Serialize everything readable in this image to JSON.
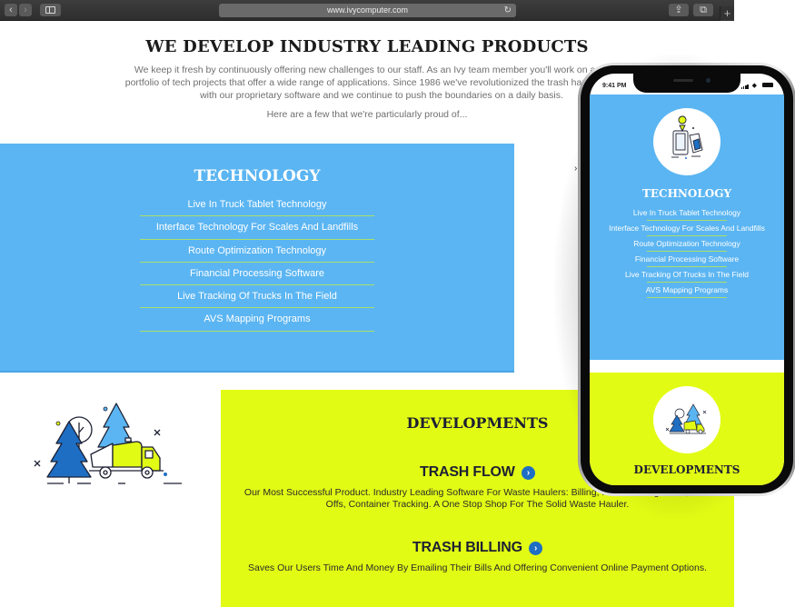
{
  "browser": {
    "url": "www.ivycomputer.com",
    "icons": [
      "back-icon",
      "forward-icon",
      "sidebar-icon",
      "reload-icon",
      "share-icon",
      "tabs-icon",
      "new-tab-icon"
    ]
  },
  "hero": {
    "title": "WE DEVELOP INDUSTRY LEADING PRODUCTS",
    "lines": [
      "We keep it fresh by continuously offering new challenges to our staff. As an Ivy team member you'll work on a diverse",
      "portfolio of tech projects that offer a wide range of applications. Since 1986 we've revolutionized the trash hauling industry",
      "with our proprietary software and we continue to push the boundaries on a daily basis."
    ],
    "subtitle": "Here are a few that we're particularly proud of..."
  },
  "technology": {
    "title": "TECHNOLOGY",
    "items": [
      "Live In Truck Tablet Technology",
      "Interface Technology For Scales And Landfills",
      "Route Optimization Technology",
      "Financial Processing Software",
      "Live Tracking Of Trucks In The Field",
      "AVS Mapping Programs"
    ],
    "color": "#5bb5f2",
    "divider_color": "#a9e06a"
  },
  "developments": {
    "title": "DEVELOPMENTS",
    "color": "#e2fb14",
    "products": [
      {
        "title": "TRASH FLOW",
        "icon": "chevron-right-circle-icon",
        "description": "Our Most Successful Product. Industry Leading Software For Waste Haulers: Billing, Route Management, Roll-Offs, Container Tracking. A One Stop Shop For The Solid Waste Hauler."
      },
      {
        "title": "TRASH BILLING",
        "icon": "chevron-right-circle-icon",
        "description": "Saves Our Users Time And Money By Emailing Their Bills And Offering Convenient Online Payment Options."
      }
    ]
  },
  "phone": {
    "status_time": "9:41 PM",
    "technology": {
      "title": "TECHNOLOGY",
      "items": [
        "Live In Truck Tablet Technology",
        "Interface Technology For Scales And Landfills",
        "Route Optimization Technology",
        "Financial Processing Software",
        "Live Tracking Of Trucks In The Field",
        "AVS Mapping Programs"
      ]
    },
    "developments": {
      "title": "DEVELOPMENTS"
    }
  },
  "glyphs": {
    "back": "‹",
    "forward": "›",
    "reload": "↻",
    "share": "⇪",
    "tabs": "⧉",
    "plus": "+",
    "chevron": "›",
    "side_arrow": "›"
  }
}
